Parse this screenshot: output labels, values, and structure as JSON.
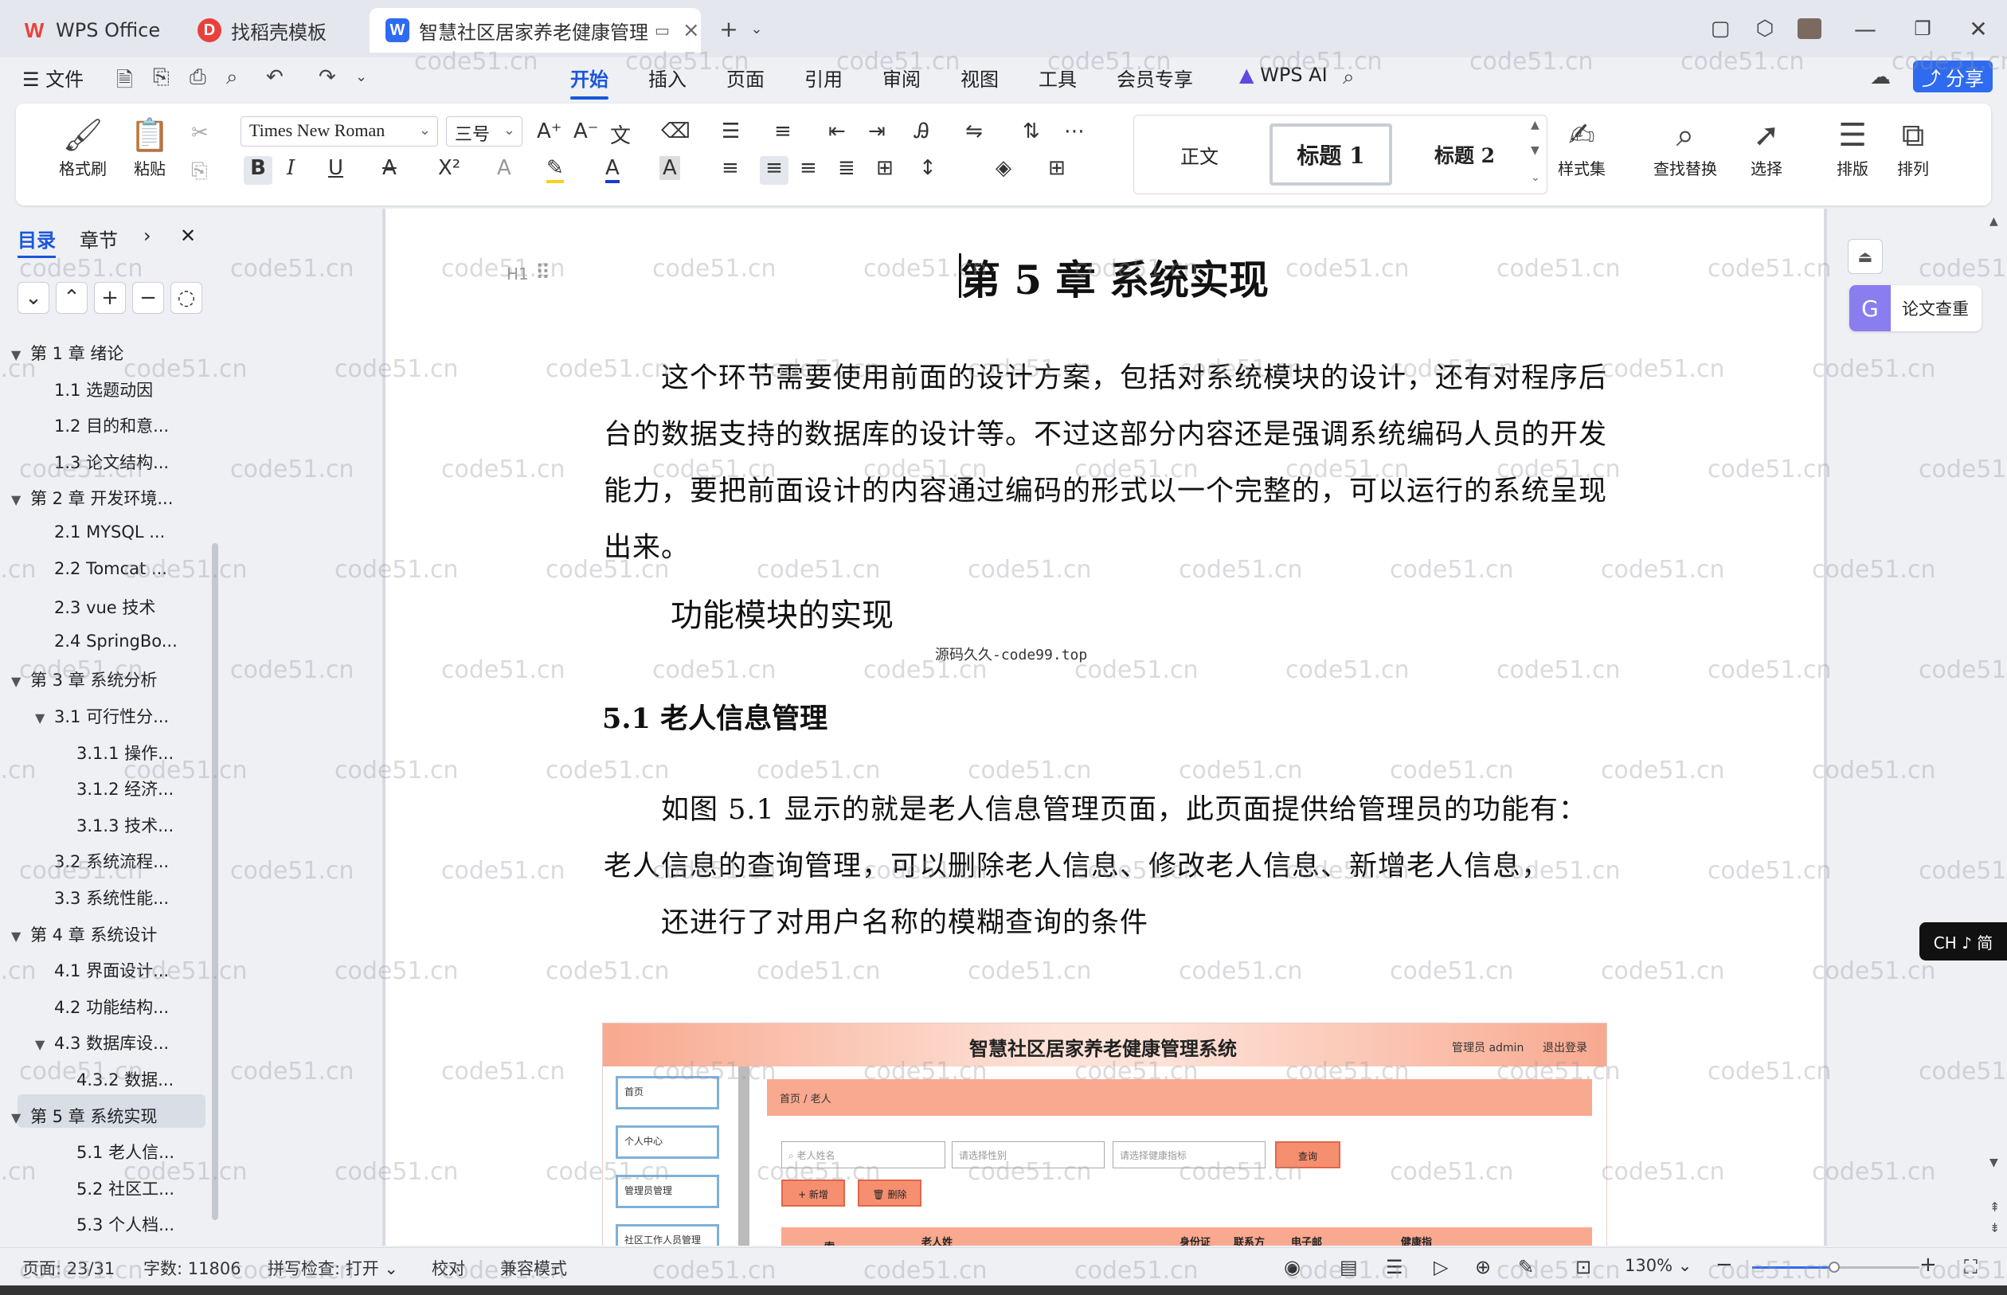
{
  "tabs": [
    {
      "label": "WPS Office"
    },
    {
      "label": "找稻壳模板"
    },
    {
      "label": "智慧社区居家养老健康管理系统"
    }
  ],
  "menu": {
    "file": "文件",
    "items": [
      "开始",
      "插入",
      "页面",
      "引用",
      "审阅",
      "视图",
      "工具",
      "会员专享"
    ],
    "wps_ai": "WPS AI",
    "share": "分享"
  },
  "ribbon": {
    "format_painter": "格式刷",
    "paste": "粘贴",
    "font_name": "Times New Roman",
    "font_size": "三号",
    "styles": [
      "正文",
      "标题  1",
      "标题  2"
    ],
    "style_set": "样式集",
    "find_replace": "查找替换",
    "select": "选择",
    "layout": "排版",
    "arrange": "排列"
  },
  "sidebar": {
    "tab_toc": "目录",
    "tab_chapter": "章节",
    "toc": [
      {
        "label": "第 1 章  绪论",
        "level": 1,
        "expanded": true
      },
      {
        "label": "1.1 选题动因",
        "level": 2
      },
      {
        "label": "1.2 目的和意...",
        "level": 2
      },
      {
        "label": "1.3 论文结构...",
        "level": 2
      },
      {
        "label": "第 2 章  开发环境...",
        "level": 1,
        "expanded": true
      },
      {
        "label": "2.1 MYSQL ...",
        "level": 2
      },
      {
        "label": "2.2 Tomcat ...",
        "level": 2
      },
      {
        "label": "2.3 vue 技术",
        "level": 2
      },
      {
        "label": "2.4 SpringBo...",
        "level": 2
      },
      {
        "label": "第 3 章  系统分析",
        "level": 1,
        "expanded": true
      },
      {
        "label": "3.1 可行性分...",
        "level": 2,
        "expanded": true
      },
      {
        "label": "3.1.1 操作...",
        "level": 3
      },
      {
        "label": "3.1.2 经济...",
        "level": 3
      },
      {
        "label": "3.1.3 技术...",
        "level": 3
      },
      {
        "label": "3.2 系统流程...",
        "level": 2
      },
      {
        "label": "3.3 系统性能...",
        "level": 2
      },
      {
        "label": "第 4 章  系统设计",
        "level": 1,
        "expanded": true
      },
      {
        "label": "4.1 界面设计...",
        "level": 2
      },
      {
        "label": "4.2 功能结构...",
        "level": 2
      },
      {
        "label": "4.3 数据库设...",
        "level": 2,
        "expanded": true
      },
      {
        "label": "4.3.2  数据...",
        "level": 3
      },
      {
        "label": "第 5 章  系统实现",
        "level": 1,
        "expanded": true,
        "active": true
      },
      {
        "label": "5.1 老人信...",
        "level": 3
      },
      {
        "label": "5.2  社区工...",
        "level": 3
      },
      {
        "label": "5.3 个人档...",
        "level": 3
      }
    ]
  },
  "document": {
    "h1_marker": "H1",
    "chapter_title": "第 5 章  系统实现",
    "para1": "这个环节需要使用前面的设计方案，包括对系统模块的设计，还有对程序后台的数据支持的数据库的设计等。不过这部分内容还是强调系统编码人员的开发能力，要把前面设计的内容通过编码的形式以一个完整的，可以运行的系统呈现出来。",
    "section_heading": "功能模块的实现",
    "source_note": "源码久久-code99.top",
    "subsection": "5.1 老人信息管理",
    "para2": "如图 5.1 显示的就是老人信息管理页面，此页面提供给管理员的功能有：老人信息的查询管理，可以删除老人信息、修改老人信息、新增老人信息，",
    "para3": "还进行了对用户名称的模糊查询的条件",
    "embed": {
      "title": "智慧社区居家养老健康管理系统",
      "admin": "管理员 admin",
      "logout": "退出登录",
      "side_items": [
        "首页",
        "个人中心",
        "管理员管理",
        "社区工作人员管理"
      ],
      "breadcrumb": "首页 / 老人",
      "search_name_ph": "老人姓名",
      "search_gender_ph": "请选择性别",
      "search_health_ph": "请选择健康指标",
      "query_btn": "查询",
      "add_btn": "+ 新增",
      "delete_btn": "删除",
      "table_headers": [
        "索",
        "老人姓",
        "身份证",
        "联系方",
        "电子邮",
        "健康指"
      ]
    }
  },
  "right_panel": {
    "plagiarism_check": "论文查重",
    "ime": "CH ♪ 简"
  },
  "status": {
    "page": "页面: 23/31",
    "words": "字数: 11806",
    "spell": "拼写检查: 打开",
    "proof": "校对",
    "compat": "兼容模式",
    "zoom": "130%"
  },
  "watermark": "code51.cn",
  "colors": {
    "accent": "#1a56db",
    "wps_red": "#e8413c",
    "embed_header": "#f8a98f",
    "embed_bar": "#f9a98f"
  }
}
